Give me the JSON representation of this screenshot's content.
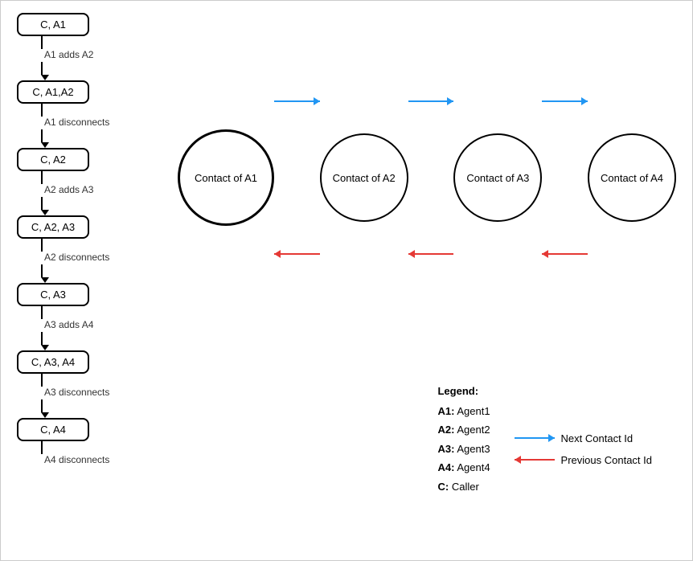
{
  "flow": {
    "nodes": [
      {
        "id": "n1",
        "label": "C, A1"
      },
      {
        "id": "n2",
        "label": "C, A1,A2"
      },
      {
        "id": "n3",
        "label": "C, A2"
      },
      {
        "id": "n4",
        "label": "C, A2, A3"
      },
      {
        "id": "n5",
        "label": "C, A3"
      },
      {
        "id": "n6",
        "label": "C, A3, A4"
      },
      {
        "id": "n7",
        "label": "C, A4"
      }
    ],
    "transitions": [
      {
        "id": "t1",
        "label": "A1 adds A2"
      },
      {
        "id": "t2",
        "label": "A1 disconnects"
      },
      {
        "id": "t3",
        "label": "A2 adds A3"
      },
      {
        "id": "t4",
        "label": "A2 disconnects"
      },
      {
        "id": "t5",
        "label": "A3 adds A4"
      },
      {
        "id": "t6",
        "label": "A3 disconnects"
      },
      {
        "id": "t7",
        "label": "A4 disconnects"
      }
    ]
  },
  "circles": [
    {
      "id": "c1",
      "label": "Contact of A1",
      "bold": true
    },
    {
      "id": "c2",
      "label": "Contact of A2"
    },
    {
      "id": "c3",
      "label": "Contact of A3"
    },
    {
      "id": "c4",
      "label": "Contact of A4"
    }
  ],
  "legend": {
    "title": "Legend:",
    "entries": [
      {
        "key": "A1:",
        "value": "Agent1"
      },
      {
        "key": "A2:",
        "value": "Agent2"
      },
      {
        "key": "A3:",
        "value": "Agent3"
      },
      {
        "key": "A4:",
        "value": "Agent4"
      },
      {
        "key": "C:",
        "value": "Caller"
      }
    ],
    "arrows": [
      {
        "id": "blue",
        "label": "Next Contact Id"
      },
      {
        "id": "red",
        "label": "Previous Contact Id"
      }
    ]
  }
}
